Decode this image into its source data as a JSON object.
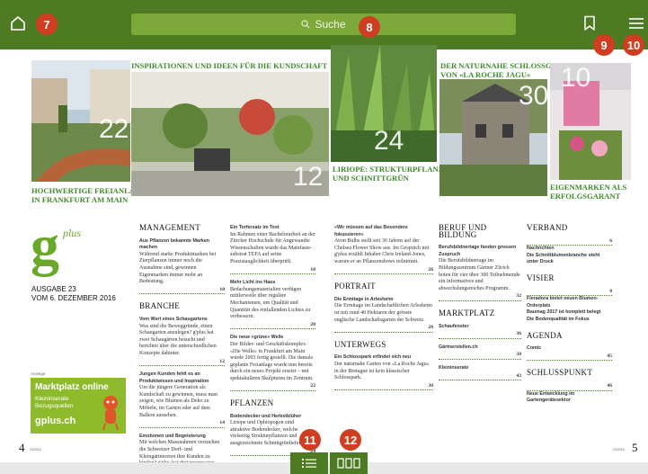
{
  "toolbar": {
    "search_placeholder": "Suche",
    "badges": {
      "home": "7",
      "search": "8",
      "bookmark": "9",
      "menu": "10"
    }
  },
  "bottom": {
    "badges": {
      "list": "11",
      "grid": "12"
    }
  },
  "photos": {
    "p22": "22",
    "p12": "12",
    "p24": "24",
    "p30": "30",
    "p10": "10"
  },
  "captions": {
    "freianlage": [
      "Hochwertige Freianlage",
      "in Frankfurt am Main"
    ],
    "inspirationen": "Inspirationen und Ideen für die Kundschaft",
    "liriope": [
      "Liriope: Strukturpflanze",
      "und Schnittgrün"
    ],
    "schlossgarten": [
      "Der naturnahe Schlossgarten",
      "von «La Roche Jagu»"
    ],
    "eigenmarken": [
      "Eigenmarken als",
      "Erfolgsgarant"
    ]
  },
  "masthead": {
    "logo_g": "g",
    "logo_plus": "plus",
    "issue": "AUSGABE 23",
    "date": "VOM 6. DEZEMBER 2016"
  },
  "ad": {
    "label": "Anzeige",
    "title": "Marktplatz online",
    "sub1": "Kleininserate",
    "sub2": "Bezugsquellen",
    "url": "gplus.ch"
  },
  "pages": {
    "left": "4",
    "right": "5",
    "left_small": "23/2016",
    "right_small": "23/2016"
  },
  "columns": {
    "management": {
      "heading": "Management",
      "items": [
        {
          "title": "Aus Pflanzen bekannte Marken machen",
          "text": "Während starke Produktmarken bei Zierpflanzen immer noch die Ausnahme sind, gewinnen Eigenmarken immer mehr an Bedeutung.",
          "page": "10"
        }
      ]
    },
    "branche": {
      "heading": "Branche",
      "items": [
        {
          "title": "Vom Wert eines Schaugartens",
          "text": "Was sind die Beweggründe, einen Schaugarten anzulegen? g'plus hat zwei Schaugärten besucht und berichtet über die unterschiedlichen Konzepte dahinter.",
          "page": "12"
        },
        {
          "title": "Jungen Kunden fehlt es an Produktwissen und Inspiration",
          "text": "Um die jüngere Generation als Kundschaft zu gewinnen, muss man zeigen, wie Blumen als Deko zu Möbeln, im Garten oder auf dem Balkon aussehen.",
          "page": "14"
        },
        {
          "title": "Emotionen und Begeisterung",
          "text": "Mit welchen Massnahmen versuchen die Schweizer Dorf- und Kleingärtnereien ihre Kunden zu binden? g'plus hat drei progressive Unternehmen befragt.",
          "page": "16"
        }
      ]
    },
    "col3": {
      "items": [
        {
          "title": "Ein Torfersatz im Test",
          "text": "Im Rahmen einer Bachelorarbeit an der Zürcher Hochschule für Angewandte Wissenschaften wurde das Mainfaser-substrat TEFA auf seine Praxistauglichkeit überprüft.",
          "page": "18"
        },
        {
          "title": "Mehr Licht ins Haus",
          "text": "Bedachungsmaterialien verfügen mittlerweile über reguläre Mechanismen, um Qualität und Quantität des einfallenden Lichtes zu verbessern.",
          "page": "20"
        },
        {
          "title": "Die neue «grüne» Welle",
          "text": "Der Bilder- und Geschäftskomplex «Die Welle» in Frankfurt am Main wurde 2003 fertig gestellt. Die damals geplante Freianlage wurde nun bereits durch ein neues Projekt ersetzt – mit spektakulären Skulpturen im Zentrum.",
          "page": "22"
        }
      ],
      "heading2": "Pflanzen",
      "items2": [
        {
          "title": "Bodendecker und Herbstblüher",
          "text": "Liriope und Ophiopogon sind attraktive Bodendecker, welche vielseitig Strukturpflanzen und ausgezeichnete Schnittgrünlieferanten.",
          "page": "24"
        }
      ]
    },
    "col4": {
      "items": [
        {
          "title": "«Wir müssen auf das Besondere fokussieren»",
          "text": "Avon Bulbs stellt seit 30 Jahren auf der Chelsea Flower Show aus. Im Gespräch mit g'plus erzählt Inhaber Chris Ireland-Jones, warum er an Pflanzenshows teilnimmt.",
          "page": "26"
        }
      ],
      "heading2": "Portrait",
      "items2": [
        {
          "title": "Die Ermitage in Arlesheim",
          "text": "Die Ermitage im Landschaftlichen Arlesheim ist mit rund 40 Hektaren der grösste englische Landschaftsgarten der Schweiz.",
          "page": "28"
        }
      ],
      "heading3": "Unterwegs",
      "items3": [
        {
          "title": "Ein Schlosspark erfindet sich neu",
          "text": "Der naturnahe Garten von «La Roche Jagu» in der Bretagne ist kein klassischer Schlosspark.",
          "page": "30"
        }
      ]
    },
    "col5": {
      "heading": "Beruf und Bildung",
      "items": [
        {
          "title": "Berufsbildnertage fanden grossen Zuspruch",
          "text": "Die Berufsbildnertage im Bildungszentrum Gärtner Zürich boten für vier über 300 Teilnehmende ein informatives und abwechslungsreiches Programm.",
          "page": "32"
        }
      ],
      "heading2": "Marktplatz",
      "items2": [
        {
          "title": "Schaufenster",
          "text": "",
          "page": "36"
        },
        {
          "title": "Gärtnerstellen.ch",
          "text": "",
          "page": "38"
        },
        {
          "title": "Kleininserate",
          "text": "",
          "page": "43"
        }
      ]
    },
    "col6": {
      "heading": "Verband",
      "items": [
        {
          "title": "Nachrichten",
          "text": "",
          "page": "6"
        },
        {
          "title": "Die Schnittblumenbranche steht unter Druck",
          "text": "",
          "page": ""
        }
      ],
      "heading2": "Visier",
      "items2": [
        {
          "title": "Fleradora bietet neuen Blumen-Orderplatz",
          "text": "",
          "page": "8"
        },
        {
          "title": "Baumag 2017 ist komplett belegt",
          "text": "",
          "page": ""
        },
        {
          "title": "Die Bodenqualität im Fokus",
          "text": "",
          "page": ""
        }
      ],
      "heading3": "Agenda",
      "items3": [
        {
          "title": "Comic",
          "text": "",
          "page": "45"
        }
      ],
      "heading4": "Schlusspunkt",
      "items4": [
        {
          "title": "Neue Entwicklung im Gartengerätesektor",
          "text": "",
          "page": "46"
        }
      ]
    }
  },
  "colors": {
    "toolbar": "#4d7a22",
    "search": "#7ca93a",
    "badge": "#cf3e20",
    "accent": "#3f8a2c",
    "ad": "#8dbb2b"
  }
}
